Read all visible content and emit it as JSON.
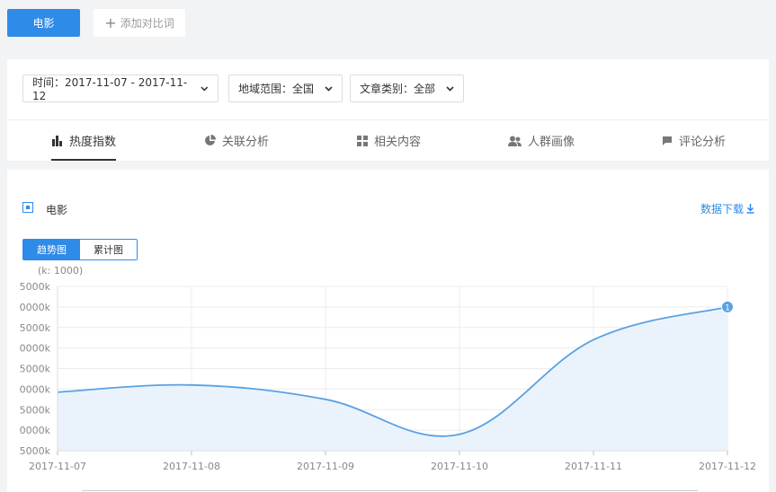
{
  "top": {
    "keyword": "电影",
    "add_compare": "添加对比词"
  },
  "filters": {
    "time": "时间：2017-11-07 - 2017-11-12",
    "region": "地域范围：全国",
    "category": "文章类别：全部"
  },
  "tabs": [
    {
      "label": "热度指数",
      "icon": "bar-chart-icon",
      "active": true
    },
    {
      "label": "关联分析",
      "icon": "pie-chart-icon",
      "active": false
    },
    {
      "label": "相关内容",
      "icon": "grid-icon",
      "active": false
    },
    {
      "label": "人群画像",
      "icon": "people-icon",
      "active": false
    },
    {
      "label": "评论分析",
      "icon": "comment-flag-icon",
      "active": false
    }
  ],
  "legend": {
    "label": "电影",
    "checked": true
  },
  "download": {
    "label": "数据下载"
  },
  "view_toggle": {
    "trend": "趋势图",
    "cumulative": "累计图",
    "active": "trend"
  },
  "colors": {
    "accent": "#2f8be8",
    "line": "#5aa1e3",
    "area": "#eaf3fc"
  },
  "chart_data": {
    "type": "area",
    "unit_label": "(k: 1000)",
    "x": [
      "2017-11-07",
      "2017-11-08",
      "2017-11-09",
      "2017-11-10",
      "2017-11-11",
      "2017-11-12"
    ],
    "y_ticks": [
      "5000k",
      "0000k",
      "5000k",
      "0000k",
      "5000k",
      "0000k",
      "5000k",
      "0000k",
      "5000k"
    ],
    "y_tick_values": [
      8,
      7,
      6,
      5,
      4,
      3,
      2,
      1,
      0
    ],
    "series": [
      {
        "values": [
          2.85,
          3.2,
          2.5,
          0.8,
          5.4,
          7.0
        ],
        "end_marker": "1"
      }
    ],
    "ylim": [
      0,
      8
    ],
    "grid": true
  }
}
